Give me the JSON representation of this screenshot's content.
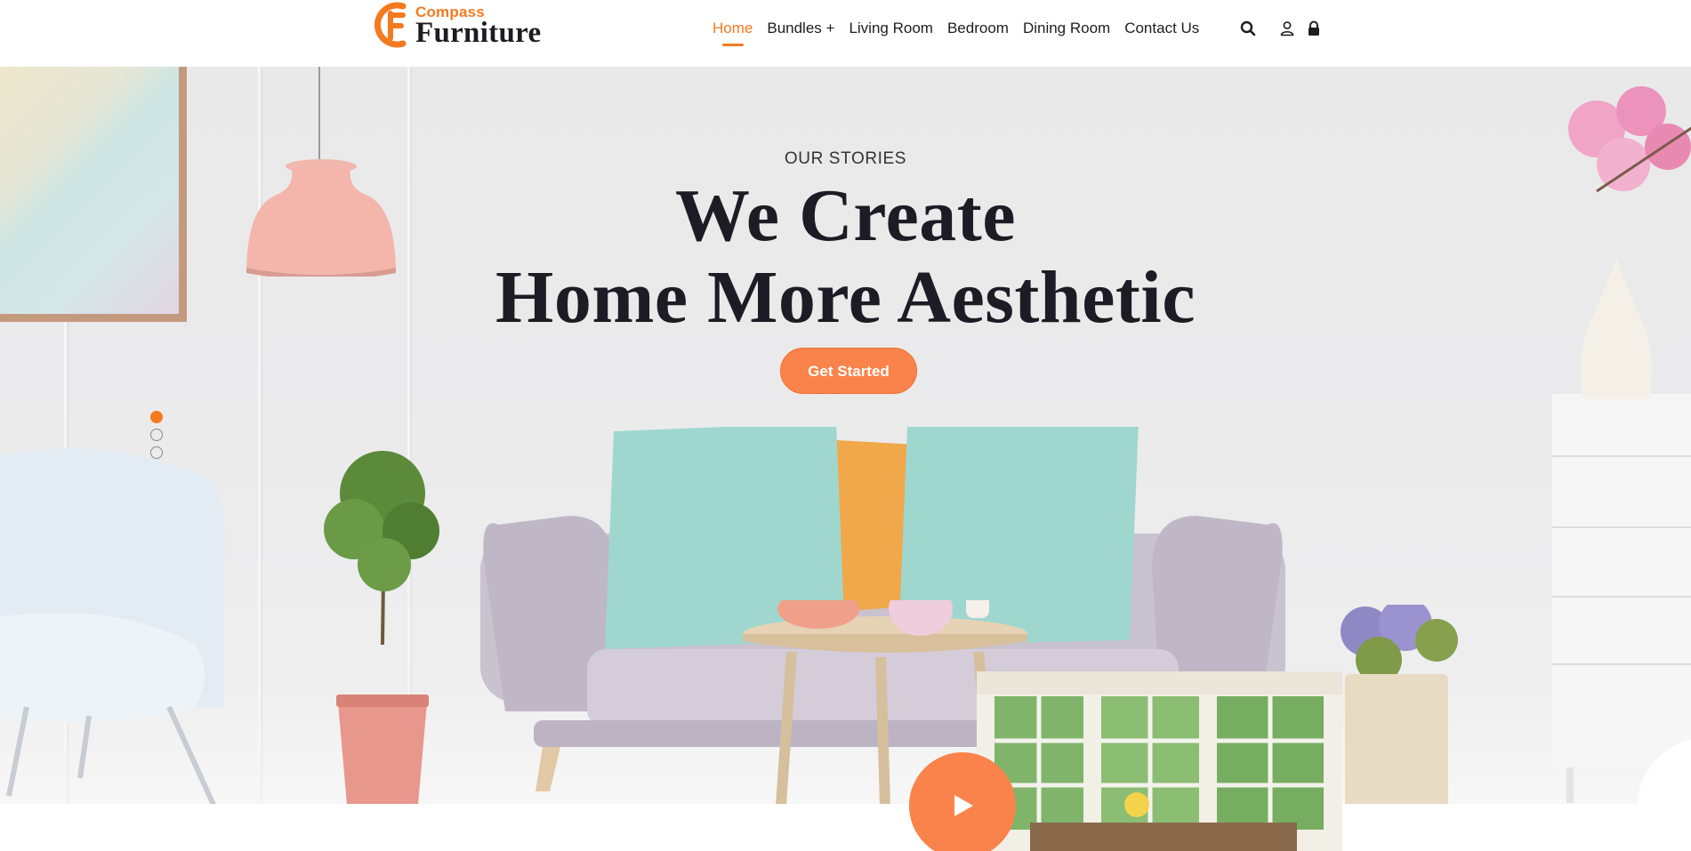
{
  "brand": {
    "name_top": "Compass",
    "name_main": "Furniture",
    "logo_icon": "compass-furniture-logo",
    "accent_color": "#f47a1f"
  },
  "nav": {
    "items": [
      {
        "label": "Home",
        "active": true
      },
      {
        "label": "Bundles +",
        "active": false
      },
      {
        "label": "Living Room",
        "active": false
      },
      {
        "label": "Bedroom",
        "active": false
      },
      {
        "label": "Dining Room",
        "active": false
      },
      {
        "label": "Contact Us",
        "active": false
      }
    ],
    "icons": [
      "search-icon",
      "user-icon",
      "lock-icon"
    ]
  },
  "hero": {
    "subtitle": "OUR STORIES",
    "title_line1": "We Create",
    "title_line2": "Home More Aesthetic",
    "cta_label": "Get Started",
    "cta_color": "#f9834a",
    "slide_count": 3,
    "active_slide": 1
  },
  "video": {
    "play_icon": "play-icon",
    "button_color": "#f9834a"
  }
}
